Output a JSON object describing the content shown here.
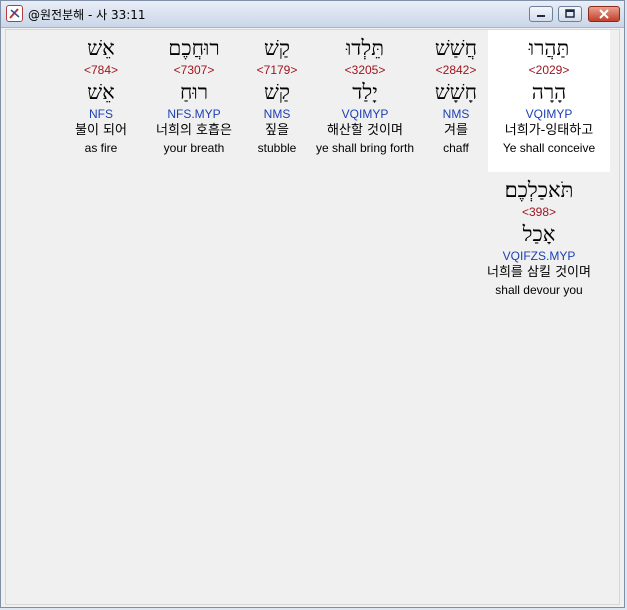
{
  "window": {
    "title": "@원전분해 - 사 33:11"
  },
  "words": [
    {
      "hebrew": "תַּהֲרוּ",
      "strong": "<2029>",
      "lemma": "הָרָה",
      "morph": "VQIMYP",
      "korean": "너희가-잉태하고",
      "english": "Ye shall conceive",
      "selected": true
    },
    {
      "hebrew": "חֲשַׁשׁ",
      "strong": "<2842>",
      "lemma": "חָשָׁשׁ",
      "morph": "NMS",
      "korean": "겨를",
      "english": "chaff",
      "selected": false
    },
    {
      "hebrew": "תֵּלְדוּ",
      "strong": "<3205>",
      "lemma": "יָלַד",
      "morph": "VQIMYP",
      "korean": "해산할 것이며",
      "english": "ye shall bring forth",
      "selected": false
    },
    {
      "hebrew": "קַשׁ",
      "strong": "<7179>",
      "lemma": "קַשׁ",
      "morph": "NMS",
      "korean": "짚을",
      "english": "stubble",
      "selected": false
    },
    {
      "hebrew": "רוּחֲכֶם",
      "strong": "<7307>",
      "lemma": "רוּחַ",
      "morph": "NFS.MYP",
      "korean": "너희의 호흡은",
      "english": "your breath",
      "selected": false
    },
    {
      "hebrew": "אֵשׁ",
      "strong": "<784>",
      "lemma": "אֵשׁ",
      "morph": "NFS",
      "korean": "불이 되어",
      "english": "as fire",
      "selected": false
    },
    {
      "hebrew": "תֹּאכַלְכֶם׃",
      "strong": "<398>",
      "lemma": "אָכַל",
      "morph": "VQIFZS.MYP",
      "korean": "너희를 삼킬 것이며",
      "english": "shall devour you",
      "selected": false
    }
  ]
}
